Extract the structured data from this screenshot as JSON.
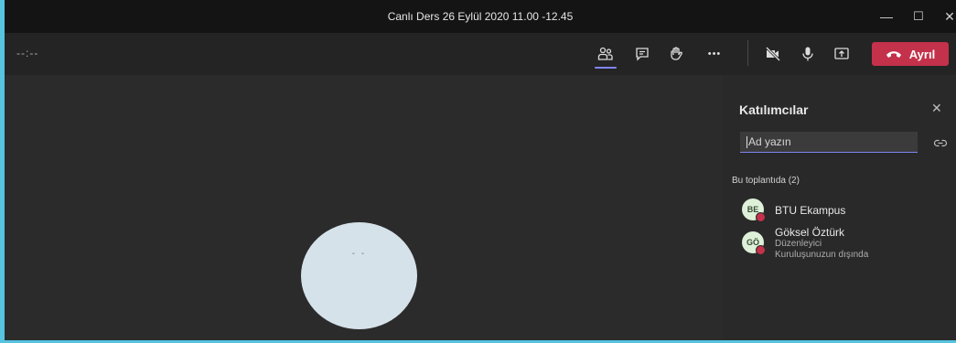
{
  "window": {
    "title": "Canlı Ders 26 Eylül 2020 11.00 -12.45"
  },
  "window_controls": {
    "minimize": "—",
    "maximize": "☐",
    "close": "✕"
  },
  "toolbar": {
    "timer": "--:--",
    "leave_label": "Ayrıl",
    "more": "•••"
  },
  "stage": {
    "avatar_initials": "- -"
  },
  "panel": {
    "title": "Katılımcılar",
    "close": "✕",
    "search": {
      "placeholder": "Ad yazın"
    },
    "section_label": "Bu toplantıda (2)",
    "participants": [
      {
        "initials": "BE",
        "name": "BTU Ekampus",
        "mic": "on"
      },
      {
        "initials": "GÖ",
        "name": "Göksel Öztürk",
        "role": "Düzenleyici",
        "note": "Kuruluşunuzun dışında",
        "mic": "muted"
      }
    ]
  },
  "colors": {
    "accent": "#7f85f5",
    "leave": "#c4314b",
    "background": "#1f1f1f",
    "panel": "#292929"
  }
}
